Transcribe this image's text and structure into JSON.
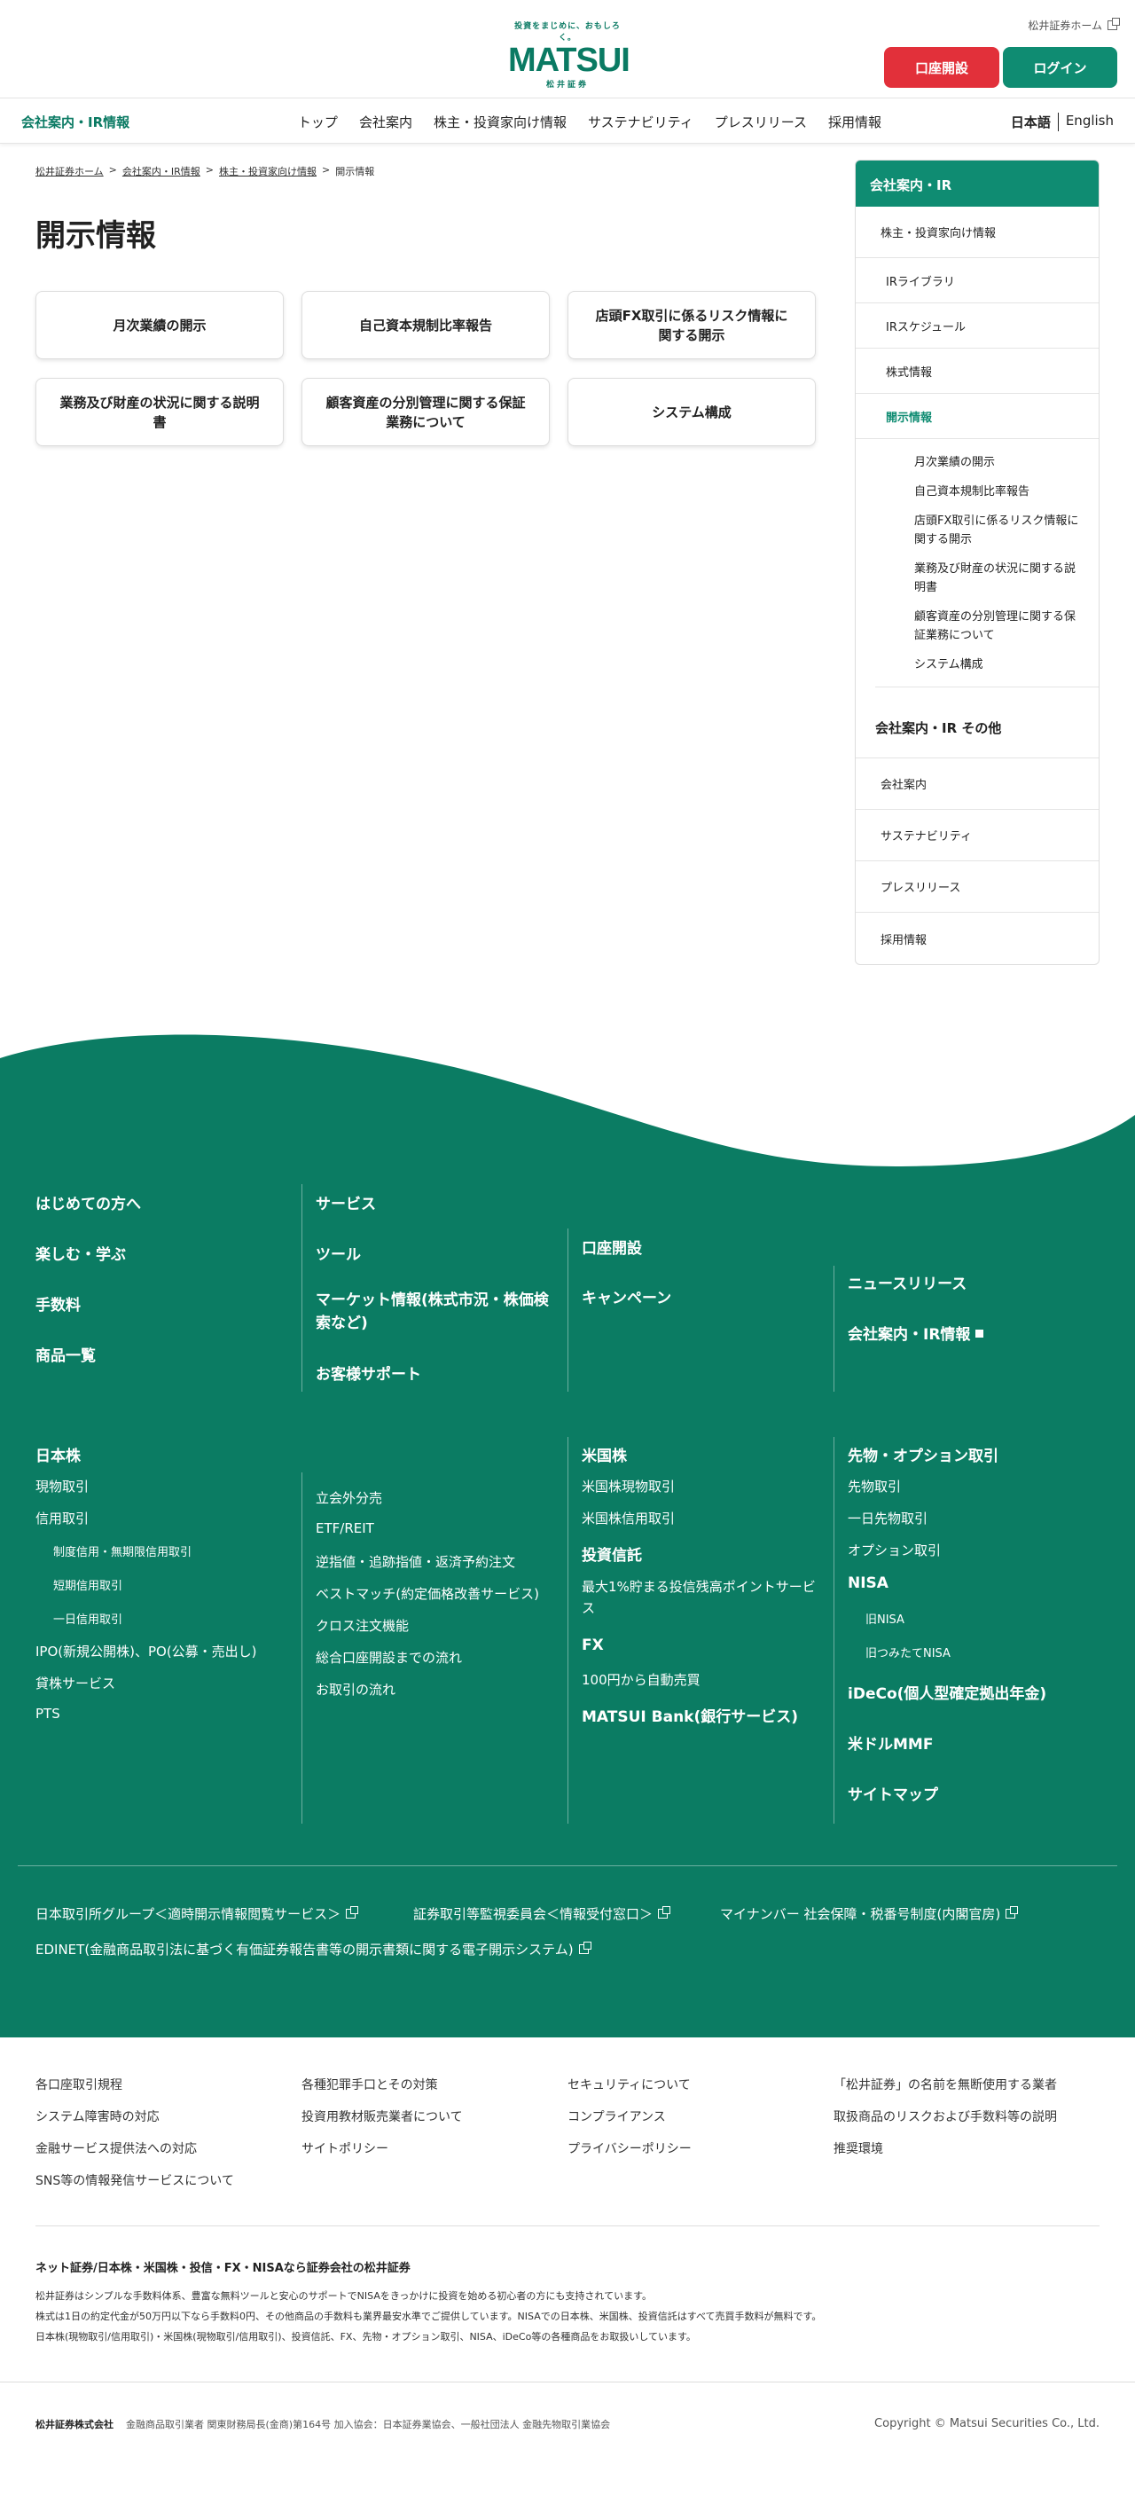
{
  "header": {
    "logo_tagline": "投資をまじめに、おもしろく。",
    "logo_main": "MATSUI",
    "logo_sub": "松井証券",
    "home_link": "松井証券ホーム",
    "open_account": "口座開設",
    "login": "ログイン"
  },
  "nav": {
    "brand": "会社案内・IR情報",
    "items": [
      "トップ",
      "会社案内",
      "株主・投資家向け情報",
      "サステナビリティ",
      "プレスリリース",
      "採用情報"
    ],
    "lang_ja": "日本語",
    "lang_en": "English"
  },
  "breadcrumb": [
    "松井証券ホーム",
    "会社案内・IR情報",
    "株主・投資家向け情報",
    "開示情報"
  ],
  "breadcrumb_sep": ">",
  "page_title": "開示情報",
  "cards": [
    "月次業績の開示",
    "自己資本規制比率報告",
    "店頭FX取引に係るリスク情報に関する開示",
    "業務及び財産の状況に関する説明書",
    "顧客資産の分別管理に関する保証業務について",
    "システム構成"
  ],
  "sidebar": {
    "head": "会社案内・IR",
    "section": "株主・投資家向け情報",
    "items": [
      "IRライブラリ",
      "IRスケジュール",
      "株式情報",
      "開示情報"
    ],
    "sub": [
      "月次業績の開示",
      "自己資本規制比率報告",
      "店頭FX取引に係るリスク情報に関する開示",
      "業務及び財産の状況に関する説明書",
      "顧客資産の分別管理に関する保証業務について",
      "システム構成"
    ],
    "other_head": "会社案内・IR その他",
    "other": [
      "会社案内",
      "サステナビリティ",
      "プレスリリース",
      "採用情報"
    ]
  },
  "footer": {
    "top": {
      "col1": [
        "はじめての方へ",
        "楽しむ・学ぶ",
        "手数料",
        "商品一覧"
      ],
      "col2": [
        "サービス",
        "ツール",
        "マーケット情報(株式市況・株価検索など)",
        "お客様サポート"
      ],
      "col3": [
        "口座開設",
        "キャンペーン"
      ],
      "col4": [
        "ニュースリリース",
        "会社案内・IR情報"
      ]
    },
    "jp": {
      "title": "日本株",
      "left": [
        "現物取引",
        "信用取引"
      ],
      "credit_sub": [
        "制度信用・無期限信用取引",
        "短期信用取引",
        "一日信用取引"
      ],
      "left2": [
        "IPO(新規公開株)、PO(公募・売出し)",
        "貸株サービス",
        "PTS"
      ],
      "right": [
        "立会外分売",
        "ETF/REIT",
        "逆指値・追跡指値・返済予約注文",
        "ベストマッチ(約定価格改善サービス)",
        "クロス注文機能",
        "総合口座開設までの流れ",
        "お取引の流れ"
      ]
    },
    "us": {
      "title": "米国株",
      "items": [
        "米国株現物取引",
        "米国株信用取引"
      ],
      "fund_title": "投資信託",
      "fund_item": "最大1%貯まる投信残高ポイントサービス",
      "fx_title": "FX",
      "fx_item": "100円から自動売買",
      "bank": "MATSUI Bank(銀行サービス)"
    },
    "fut": {
      "title": "先物・オプション取引",
      "items": [
        "先物取引",
        "一日先物取引",
        "オプション取引"
      ],
      "nisa_title": "NISA",
      "nisa_items": [
        "旧NISA",
        "旧つみたてNISA"
      ],
      "ideco": "iDeCo(個人型確定拠出年金)",
      "mmf": "米ドルMMF",
      "sitemap": "サイトマップ"
    },
    "ext": [
      "日本取引所グループ＜適時開示情報閲覧サービス＞",
      "証券取引等監視委員会＜情報受付窓口＞",
      "マイナンバー 社会保障・税番号制度(内閣官房)",
      "EDINET(金融商品取引法に基づく有価証券報告書等の開示書類に関する電子開示システム)"
    ],
    "links": [
      [
        "各口座取引規程",
        "システム障害時の対応",
        "金融サービス提供法への対応",
        "SNS等の情報発信サービスについて"
      ],
      [
        "各種犯罪手口とその対策",
        "投資用教材販売業者について",
        "サイトポリシー"
      ],
      [
        "セキュリティについて",
        "コンプライアンス",
        "プライバシーポリシー"
      ],
      [
        "「松井証券」の名前を無断使用する業者",
        "取扱商品のリスクおよび手数料等の説明",
        "推奨環境"
      ]
    ],
    "about_title": "ネット証券/日本株・米国株・投信・FX・NISAなら証券会社の松井証券",
    "about_lines": [
      "松井証券はシンプルな手数料体系、豊富な無料ツールと安心のサポートでNISAをきっかけに投資を始める初心者の方にも支持されています。",
      "株式は1日の約定代金が50万円以下なら手数料0円、その他商品の手数料も業界最安水準でご提供しています。NISAでの日本株、米国株、投資信託はすべて売買手数料が無料です。",
      "日本株(現物取引/信用取引)・米国株(現物取引/信用取引)、投資信託、FX、先物・オプション取引、NISA、iDeCo等の各種商品をお取扱いしています。"
    ],
    "corp_name": "松井証券株式会社",
    "corp_info": "金融商品取引業者 関東財務局長(金商)第164号 加入協会：日本証券業協会、一般社団法人 金融先物取引業協会",
    "copyright": "Copyright © Matsui Securities Co., Ltd."
  },
  "colors": {
    "brand_green": "#0f8c72",
    "footer_green": "#0b7c63",
    "red": "#e2303a"
  }
}
